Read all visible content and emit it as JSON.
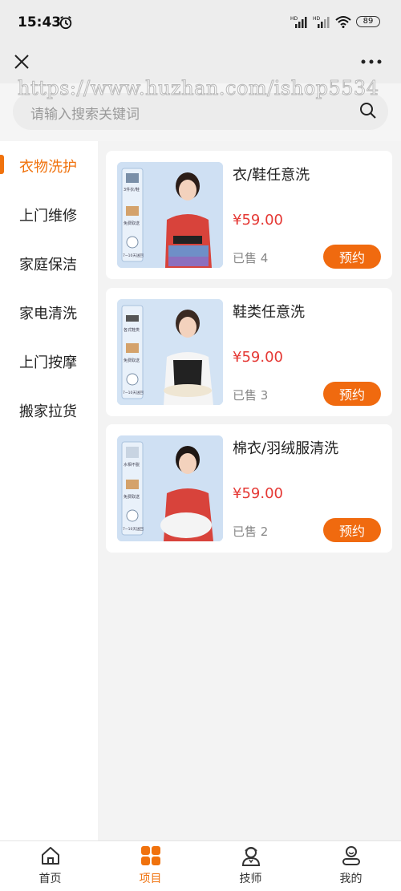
{
  "status": {
    "time": "15:43",
    "battery": "89",
    "signal1": "HD",
    "signal2": "HD"
  },
  "watermark": "https://www.huzhan.com/ishop5534",
  "search": {
    "placeholder": "请输入搜索关键词"
  },
  "sidebar": {
    "items": [
      {
        "label": "衣物洗护",
        "active": true
      },
      {
        "label": "上门维修"
      },
      {
        "label": "家庭保洁"
      },
      {
        "label": "家电清洗"
      },
      {
        "label": "上门按摩"
      },
      {
        "label": "搬家拉货"
      }
    ]
  },
  "products": [
    {
      "title": "衣/鞋任意洗",
      "price": "¥59.00",
      "sold": "已售 4",
      "button": "预约",
      "img_tags": [
        "3件衣/鞋",
        "免费取送",
        "7~10天送回"
      ]
    },
    {
      "title": "鞋类任意洗",
      "price": "¥59.00",
      "sold": "已售 3",
      "button": "预约",
      "img_tags": [
        "各式鞋类",
        "免费取送",
        "7~10天送回"
      ]
    },
    {
      "title": "棉衣/羽绒服清洗",
      "price": "¥59.00",
      "sold": "已售 2",
      "button": "预约",
      "img_tags": [
        "水相不脱",
        "免费取送",
        "7~10天送回"
      ]
    }
  ],
  "tabbar": {
    "items": [
      {
        "label": "首页",
        "icon": "home-icon"
      },
      {
        "label": "项目",
        "icon": "grid-icon",
        "active": true
      },
      {
        "label": "技师",
        "icon": "technician-icon"
      },
      {
        "label": "我的",
        "icon": "profile-icon"
      }
    ]
  },
  "colors": {
    "accent": "#f0720d",
    "price": "#e53935",
    "button": "#f06a0f"
  }
}
